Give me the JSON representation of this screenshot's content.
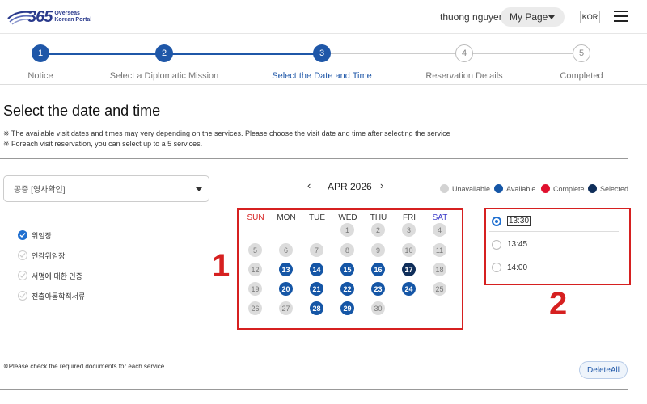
{
  "header": {
    "logo_number": "365",
    "logo_line1": "Overseas",
    "logo_line2": "Korean Portal",
    "user_name": "thuong nguyen",
    "mypage_label": "My Page",
    "lang_label": "KOR"
  },
  "steps": [
    {
      "num": "1",
      "label": "Notice",
      "state": "done"
    },
    {
      "num": "2",
      "label": "Select a Diplomatic Mission",
      "state": "done"
    },
    {
      "num": "3",
      "label": "Select the Date and Time",
      "state": "active"
    },
    {
      "num": "4",
      "label": "Reservation Details",
      "state": "todo"
    },
    {
      "num": "5",
      "label": "Completed",
      "state": "todo"
    }
  ],
  "page_title": "Select the date and time",
  "notices": [
    "※ The available visit dates and times may very depending on the services. Please choose the visit date and time after selecting the service",
    "※ Foreach visit reservation, you can select up to a 5 services."
  ],
  "service_select": {
    "value": "공증 [영사확인]"
  },
  "services": [
    {
      "label": "위임장",
      "checked": true
    },
    {
      "label": "인감위임장",
      "checked": false
    },
    {
      "label": "서명에 대한 인증",
      "checked": false
    },
    {
      "label": "전출아동학적서류",
      "checked": false
    }
  ],
  "calendar": {
    "month_label": "APR 2026",
    "prev_arrow": "‹",
    "next_arrow": "›",
    "weekdays": [
      "SUN",
      "MON",
      "TUE",
      "WED",
      "THU",
      "FRI",
      "SAT"
    ],
    "weeks": [
      [
        null,
        null,
        null,
        {
          "d": "1",
          "s": "unavail"
        },
        {
          "d": "2",
          "s": "unavail"
        },
        {
          "d": "3",
          "s": "unavail"
        },
        {
          "d": "4",
          "s": "unavail"
        }
      ],
      [
        {
          "d": "5",
          "s": "unavail"
        },
        {
          "d": "6",
          "s": "unavail"
        },
        {
          "d": "7",
          "s": "unavail"
        },
        {
          "d": "8",
          "s": "unavail"
        },
        {
          "d": "9",
          "s": "unavail"
        },
        {
          "d": "10",
          "s": "unavail"
        },
        {
          "d": "11",
          "s": "unavail"
        }
      ],
      [
        {
          "d": "12",
          "s": "unavail"
        },
        {
          "d": "13",
          "s": "avail"
        },
        {
          "d": "14",
          "s": "avail"
        },
        {
          "d": "15",
          "s": "avail"
        },
        {
          "d": "16",
          "s": "avail"
        },
        {
          "d": "17",
          "s": "selected"
        },
        {
          "d": "18",
          "s": "unavail"
        }
      ],
      [
        {
          "d": "19",
          "s": "unavail"
        },
        {
          "d": "20",
          "s": "avail"
        },
        {
          "d": "21",
          "s": "avail"
        },
        {
          "d": "22",
          "s": "avail"
        },
        {
          "d": "23",
          "s": "avail"
        },
        {
          "d": "24",
          "s": "avail"
        },
        {
          "d": "25",
          "s": "unavail"
        }
      ],
      [
        {
          "d": "26",
          "s": "unavail"
        },
        {
          "d": "27",
          "s": "unavail"
        },
        {
          "d": "28",
          "s": "avail"
        },
        {
          "d": "29",
          "s": "avail"
        },
        {
          "d": "30",
          "s": "unavail"
        },
        null,
        null
      ]
    ]
  },
  "legend": [
    {
      "label": "Unavailable",
      "color": "#d3d3d3"
    },
    {
      "label": "Available",
      "color": "#1556a6"
    },
    {
      "label": "Complete",
      "color": "#e0102e"
    },
    {
      "label": "Selected",
      "color": "#0f2e5a"
    }
  ],
  "times": [
    {
      "label": "13:30",
      "selected": true
    },
    {
      "label": "13:45",
      "selected": false
    },
    {
      "label": "14:00",
      "selected": false
    }
  ],
  "annotations": {
    "box1": "1",
    "box2": "2"
  },
  "footer_note": "※Please check the required documents for each service.",
  "delete_all_label": "DeleteAll",
  "colors": {
    "primary": "#1f57a8",
    "accent_red": "#d62020",
    "available": "#1556a6",
    "selected": "#0f2e5a"
  }
}
